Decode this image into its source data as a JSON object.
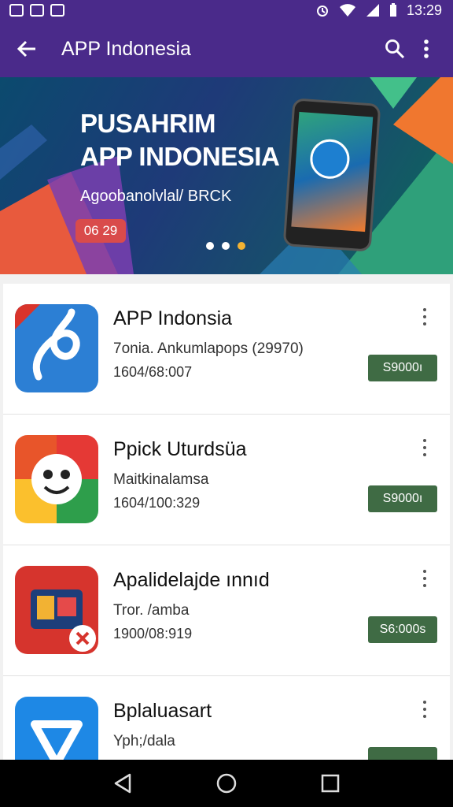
{
  "status_bar": {
    "time": "13:29"
  },
  "app_bar": {
    "title": "APP Indonesia"
  },
  "banner": {
    "title_line1": "PUSAHRIM",
    "title_line2": "APP INDONESIA",
    "subtitle": "Agoobanolvlal/ BRCK",
    "badge": "06 29"
  },
  "apps": [
    {
      "name": "APP Indonsia",
      "subtitle": "7onia. Ankumlapops (29970)",
      "meta": "1604/68:007",
      "button": "S9000ı"
    },
    {
      "name": "Ppick Uturdsüa",
      "subtitle": "Maitkinalamsa",
      "meta": "1604/100:329",
      "button": "S9000ı"
    },
    {
      "name": "Apalidelajde ınnıd",
      "subtitle": "Tror. /amba",
      "meta": "1900/08:919",
      "button": "S6:000s"
    },
    {
      "name": "Bplaluasart",
      "subtitle": "Yph;/dala",
      "meta": "",
      "button": ""
    }
  ],
  "colors": {
    "primary": "#4a2a8a",
    "button": "#3f6b44",
    "badge": "#d94b4b"
  }
}
